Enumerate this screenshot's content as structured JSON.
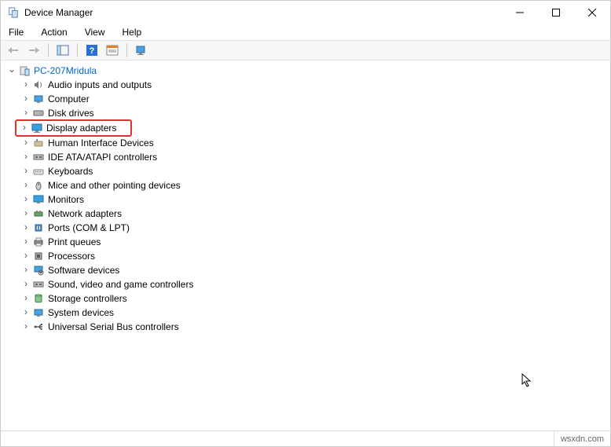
{
  "window": {
    "title": "Device Manager"
  },
  "menu": {
    "file": "File",
    "action": "Action",
    "view": "View",
    "help": "Help"
  },
  "tree": {
    "root": "PC-207Mridula",
    "items": [
      "Audio inputs and outputs",
      "Computer",
      "Disk drives",
      "Display adapters",
      "Human Interface Devices",
      "IDE ATA/ATAPI controllers",
      "Keyboards",
      "Mice and other pointing devices",
      "Monitors",
      "Network adapters",
      "Ports (COM & LPT)",
      "Print queues",
      "Processors",
      "Software devices",
      "Sound, video and game controllers",
      "Storage controllers",
      "System devices",
      "Universal Serial Bus controllers"
    ]
  },
  "footer": {
    "watermark": "wsxdn.com"
  }
}
